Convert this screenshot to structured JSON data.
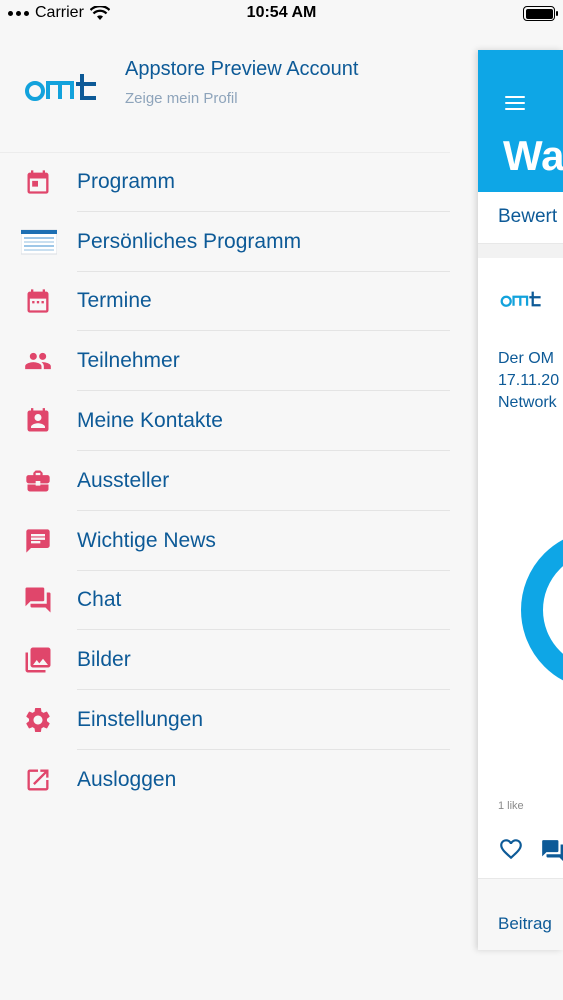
{
  "status_bar": {
    "carrier": "Carrier",
    "time": "10:54 AM"
  },
  "profile": {
    "name": "Appstore Preview Account",
    "subtitle": "Zeige mein Profil",
    "logo_text": "OMT"
  },
  "menu": {
    "items": [
      {
        "label": "Programm",
        "icon": "calendar-icon"
      },
      {
        "label": "Persönliches Programm",
        "icon": "schedule-thumbnail-icon"
      },
      {
        "label": "Termine",
        "icon": "calendar-grid-icon"
      },
      {
        "label": "Teilnehmer",
        "icon": "people-icon"
      },
      {
        "label": "Meine Kontakte",
        "icon": "contact-card-icon"
      },
      {
        "label": "Aussteller",
        "icon": "briefcase-icon"
      },
      {
        "label": "Wichtige News",
        "icon": "news-message-icon"
      },
      {
        "label": "Chat",
        "icon": "chat-bubbles-icon"
      },
      {
        "label": "Bilder",
        "icon": "images-icon"
      },
      {
        "label": "Einstellungen",
        "icon": "gear-icon"
      },
      {
        "label": "Ausloggen",
        "icon": "external-link-icon"
      }
    ]
  },
  "panel": {
    "title": "Wa",
    "tab": "Bewert",
    "card_text": [
      "Der OM",
      "17.11.20",
      "Network"
    ],
    "likes": "1 like",
    "footer": "Beitrag"
  },
  "colors": {
    "accent_blue": "#0ea6e6",
    "text_blue": "#0d5a97",
    "icon_pink": "#e0466b",
    "muted": "#8ea4bb"
  }
}
